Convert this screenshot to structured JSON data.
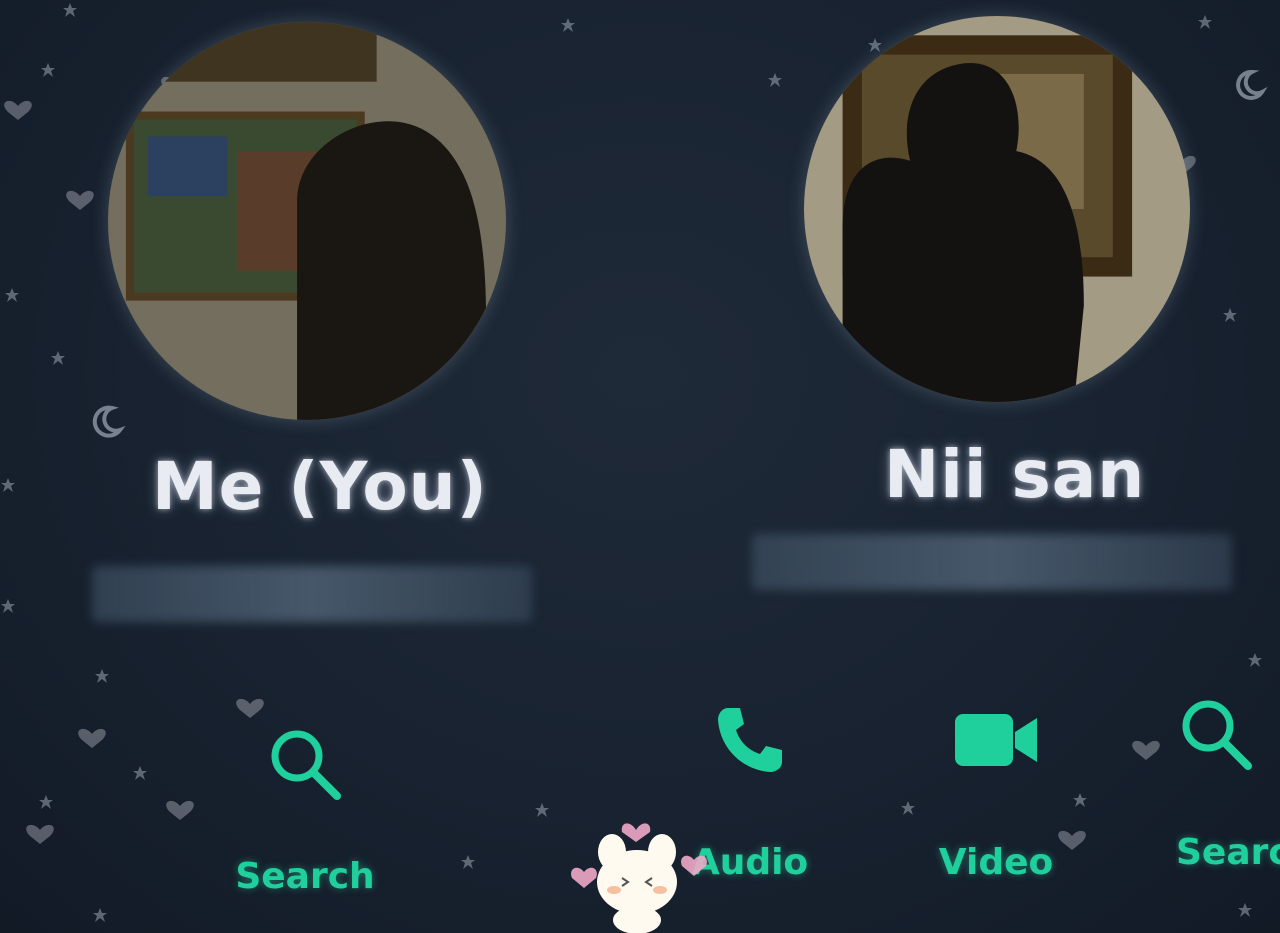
{
  "contacts": {
    "me": {
      "name": "Me (You)"
    },
    "other": {
      "name": "Nii san"
    }
  },
  "actions": {
    "search_me": {
      "label": "Search",
      "icon": "search-icon"
    },
    "audio": {
      "label": "Audio",
      "icon": "phone-icon"
    },
    "video": {
      "label": "Video",
      "icon": "video-camera-icon"
    },
    "search_other": {
      "label": "Search",
      "icon": "search-icon"
    }
  },
  "colors": {
    "background": "#182230",
    "accent": "#1fcf9c",
    "name_text": "#e8ecf2"
  }
}
